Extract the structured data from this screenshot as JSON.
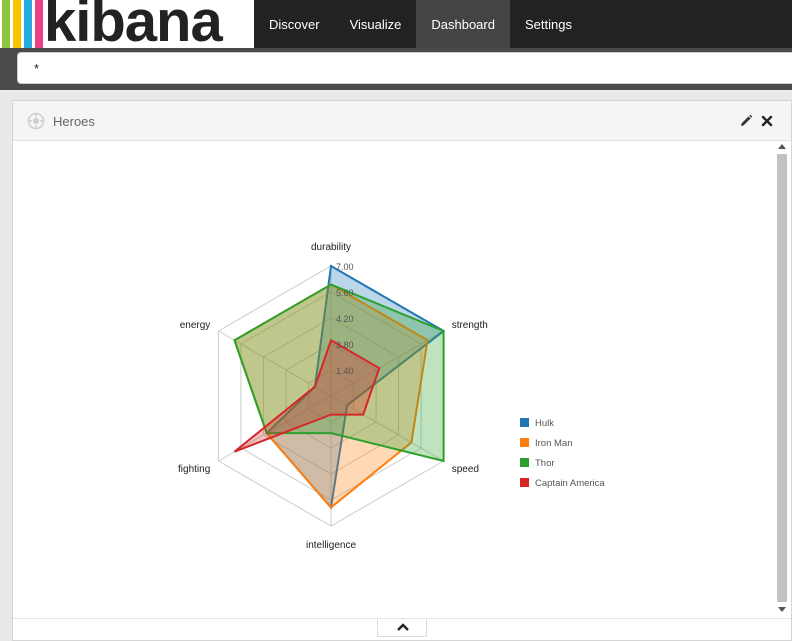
{
  "app": {
    "logo_text": "kibana",
    "logo_colors": [
      "#8cc63f",
      "#f9c300",
      "#24ace2",
      "#ee3f86"
    ]
  },
  "nav": {
    "items": [
      {
        "label": "Discover",
        "active": false
      },
      {
        "label": "Visualize",
        "active": false
      },
      {
        "label": "Dashboard",
        "active": true
      },
      {
        "label": "Settings",
        "active": false
      }
    ]
  },
  "query": {
    "value": "*"
  },
  "panel": {
    "title": "Heroes",
    "icon": "gear-icon"
  },
  "colors": {
    "nav_active": "#444444",
    "topbar": "#222222"
  },
  "chart_data": {
    "type": "radar",
    "axes": [
      "durability",
      "strength",
      "speed",
      "intelligence",
      "fighting",
      "energy"
    ],
    "scale_labels": [
      "1.40",
      "2.80",
      "4.20",
      "5.60",
      "7.00"
    ],
    "max": 7.0,
    "grid": true,
    "legend_position": "right",
    "series": [
      {
        "name": "Hulk",
        "color": "#1f77b4",
        "values": [
          7,
          7,
          1,
          6,
          4,
          1
        ]
      },
      {
        "name": "Iron Man",
        "color": "#ff7f0e",
        "values": [
          6,
          6,
          5,
          6,
          4,
          6
        ]
      },
      {
        "name": "Thor",
        "color": "#2ca02c",
        "values": [
          6,
          7,
          7,
          2,
          4,
          6
        ]
      },
      {
        "name": "Captain America",
        "color": "#d62728",
        "values": [
          3,
          3,
          2,
          1,
          6,
          1
        ]
      }
    ]
  }
}
